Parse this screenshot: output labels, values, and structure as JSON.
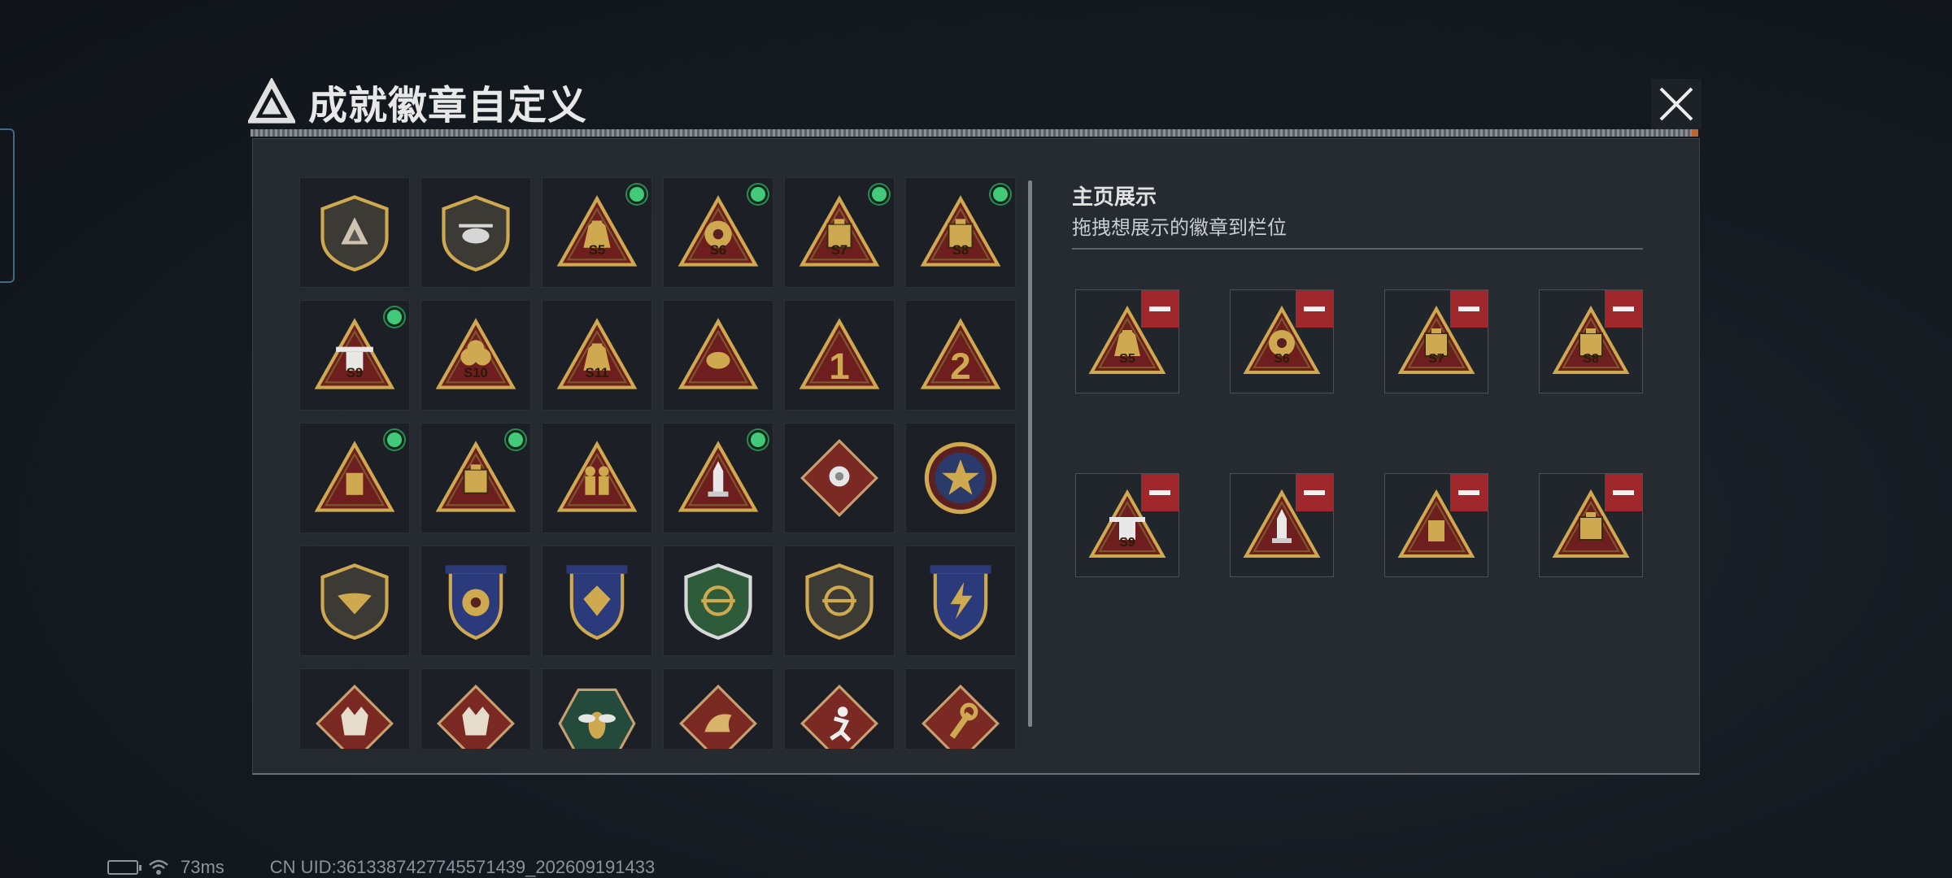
{
  "window": {
    "title": "成就徽章自定义"
  },
  "badges": [
    {
      "icon": "shield-delta-badge",
      "shape": "shield",
      "motif": "delta",
      "label": "",
      "new": false
    },
    {
      "icon": "helicopter-shield-badge",
      "shape": "shield",
      "motif": "heli",
      "label": "",
      "new": false
    },
    {
      "icon": "season-s5-badge",
      "shape": "tri",
      "motif": "bag",
      "label": "S5",
      "new": true
    },
    {
      "icon": "season-s6-badge",
      "shape": "tri",
      "motif": "orb",
      "label": "S6",
      "new": true
    },
    {
      "icon": "season-s7-badge",
      "shape": "tri",
      "motif": "box",
      "label": "S7",
      "new": true
    },
    {
      "icon": "season-s8-badge",
      "shape": "tri",
      "motif": "box",
      "label": "S8",
      "new": true
    },
    {
      "icon": "season-s9-badge",
      "shape": "tri",
      "motif": "drone",
      "label": "S9",
      "new": true
    },
    {
      "icon": "season-s10-badge",
      "shape": "tri",
      "motif": "fist",
      "label": "S10",
      "new": false
    },
    {
      "icon": "season-s11-badge",
      "shape": "tri",
      "motif": "bag",
      "label": "S11",
      "new": false
    },
    {
      "icon": "egg-triangle-badge",
      "shape": "tri",
      "motif": "egg",
      "label": "",
      "new": false
    },
    {
      "icon": "number-one-badge",
      "shape": "tri",
      "motif": "num",
      "label": "1",
      "new": false
    },
    {
      "icon": "number-two-badge",
      "shape": "tri",
      "motif": "num",
      "label": "2",
      "new": false
    },
    {
      "icon": "card-triangle-badge",
      "shape": "tri",
      "motif": "card",
      "label": "",
      "new": true
    },
    {
      "icon": "lantern-triangle-badge",
      "shape": "tri",
      "motif": "box",
      "label": "",
      "new": true
    },
    {
      "icon": "soldiers-triangle-badge",
      "shape": "tri",
      "motif": "soldier",
      "label": "",
      "new": false
    },
    {
      "icon": "rocket-triangle-badge",
      "shape": "tri",
      "motif": "rocket",
      "label": "",
      "new": true
    },
    {
      "icon": "rose-diamond-badge",
      "shape": "diamond",
      "motif": "rose",
      "label": "",
      "new": false
    },
    {
      "icon": "star-round-badge",
      "shape": "round",
      "motif": "star",
      "label": "",
      "new": false
    },
    {
      "icon": "wings-shield-badge",
      "shape": "shield",
      "motif": "wing",
      "label": "",
      "new": false
    },
    {
      "icon": "crest-blue-badge",
      "shape": "crest",
      "motif": "orb",
      "label": "",
      "new": false
    },
    {
      "icon": "crest-red-badge",
      "shape": "crest",
      "motif": "gem",
      "label": "",
      "new": false
    },
    {
      "icon": "green-sniper-shield-badge",
      "shape": "greenshield",
      "motif": "scope",
      "label": "",
      "new": false
    },
    {
      "icon": "rifle-scope-shield-badge",
      "shape": "shield",
      "motif": "scope",
      "label": "",
      "new": false
    },
    {
      "icon": "lightning-crest-badge",
      "shape": "crest",
      "motif": "bolt",
      "label": "",
      "new": false
    },
    {
      "icon": "wolf-diamond-badge",
      "shape": "diamond",
      "motif": "wolf",
      "label": "",
      "new": false
    },
    {
      "icon": "wolf2-diamond-badge",
      "shape": "diamond",
      "motif": "wolf",
      "label": "",
      "new": false
    },
    {
      "icon": "wasp-hex-badge",
      "shape": "hex",
      "motif": "wasp",
      "label": "",
      "new": false
    },
    {
      "icon": "dragon-diamond-badge",
      "shape": "diamond",
      "motif": "dragon",
      "label": "",
      "new": false
    },
    {
      "icon": "runner-diamond-badge",
      "shape": "diamond",
      "motif": "runner",
      "label": "",
      "new": false
    },
    {
      "icon": "wrench-diamond-badge",
      "shape": "diamond",
      "motif": "wrench",
      "label": "",
      "new": false
    }
  ],
  "showcase": {
    "title": "主页展示",
    "subtitle": "拖拽想展示的徽章到栏位",
    "slots": [
      {
        "icon": "season-s5-badge",
        "shape": "tri",
        "motif": "bag",
        "label": "S5"
      },
      {
        "icon": "season-s6-badge",
        "shape": "tri",
        "motif": "orb",
        "label": "S6"
      },
      {
        "icon": "season-s7-badge",
        "shape": "tri",
        "motif": "box",
        "label": "S7"
      },
      {
        "icon": "season-s8-badge",
        "shape": "tri",
        "motif": "box",
        "label": "S8"
      },
      {
        "icon": "season-s9-badge",
        "shape": "tri",
        "motif": "drone",
        "label": "S9"
      },
      {
        "icon": "rocket-triangle-badge",
        "shape": "tri",
        "motif": "rocket",
        "label": ""
      },
      {
        "icon": "card-triangle-badge",
        "shape": "tri",
        "motif": "card",
        "label": ""
      },
      {
        "icon": "lantern-triangle-badge",
        "shape": "tri",
        "motif": "box",
        "label": ""
      }
    ]
  },
  "status": {
    "ping": "73ms",
    "uid": "CN UID:3613387427745571439_202609191433"
  },
  "colors": {
    "gold": "#cfa94f",
    "dark_red": "#6e1e1e",
    "new_dot": "#42c97a",
    "remove_red": "#a0282c"
  }
}
